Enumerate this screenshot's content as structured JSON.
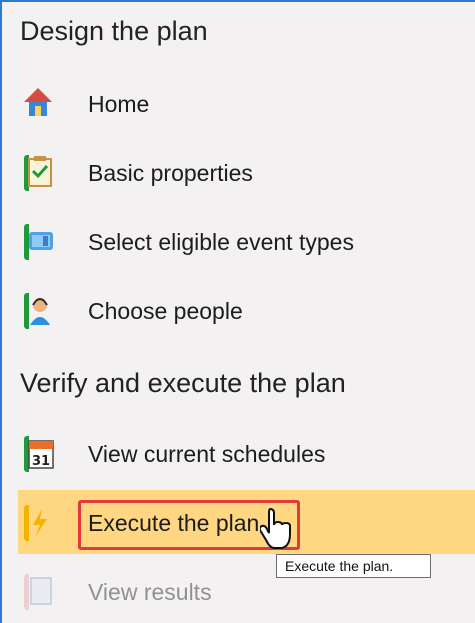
{
  "sections": [
    {
      "title": "Design the plan"
    },
    {
      "title": "Verify and execute the plan"
    }
  ],
  "items": [
    {
      "label": "Home",
      "icon": "home-icon"
    },
    {
      "label": "Basic properties",
      "icon": "checklist-icon"
    },
    {
      "label": "Select eligible event types",
      "icon": "event-types-icon"
    },
    {
      "label": "Choose people",
      "icon": "people-icon"
    },
    {
      "label": "View current schedules",
      "icon": "calendar-icon",
      "calendar_day": "31"
    },
    {
      "label": "Execute the plan",
      "icon": "execute-icon",
      "state": "hover"
    },
    {
      "label": "View results",
      "icon": "document-icon",
      "state": "disabled"
    }
  ],
  "tooltip": {
    "text": "Execute the plan."
  },
  "colors": {
    "accent": "#2b7bd1",
    "highlight": "#ffd783",
    "focus_border": "#e23a3a"
  }
}
